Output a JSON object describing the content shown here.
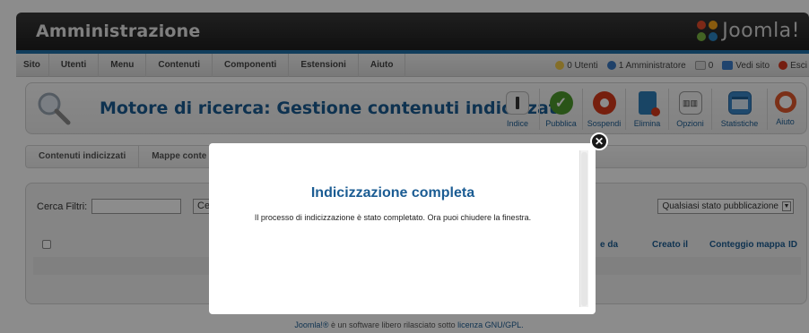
{
  "header": {
    "brand": "Amministrazione",
    "logo_text": "Joomla!"
  },
  "menu": {
    "items": [
      "Sito",
      "Utenti",
      "Menu",
      "Contenuti",
      "Componenti",
      "Estensioni",
      "Aiuto"
    ],
    "status": {
      "visitors": "0 Utenti",
      "admins": "1 Amministratore",
      "messages": "0",
      "view_site": "Vedi sito",
      "logout": "Esci"
    }
  },
  "toolbar": {
    "title": "Motore di ricerca: Gestione contenuti indicizzati",
    "buttons": [
      {
        "label": "Indice",
        "icon": "index-icon"
      },
      {
        "label": "Pubblica",
        "icon": "publish-icon"
      },
      {
        "label": "Sospendi",
        "icon": "unpublish-icon"
      },
      {
        "label": "Elimina",
        "icon": "trash-icon"
      },
      {
        "label": "Opzioni",
        "icon": "options-icon"
      },
      {
        "label": "Statistiche",
        "icon": "statistics-icon"
      },
      {
        "label": "Aiuto",
        "icon": "help-icon"
      }
    ]
  },
  "subtabs": [
    "Contenuti indicizzati",
    "Mappe conte"
  ],
  "filters": {
    "search_label": "Cerca Filtri:",
    "search_value": "",
    "search_button": "Ce",
    "state_select": "Qualsiasi stato pubblicazione"
  },
  "table": {
    "headers": [
      "e da",
      "Creato il",
      "Conteggio mappa",
      "ID"
    ]
  },
  "footer": {
    "brand_link": "Joomla!®",
    "text": " è un software libero rilasciato sotto ",
    "license_link": "licenza GNU/GPL."
  },
  "modal": {
    "title": "Indicizzazione completa",
    "message": "Il processo di indicizzazione è stato completato. Ora puoi chiudere la finestra."
  },
  "colors": {
    "accent": "#1b5c93",
    "menu_border": "#1f6fa8"
  }
}
